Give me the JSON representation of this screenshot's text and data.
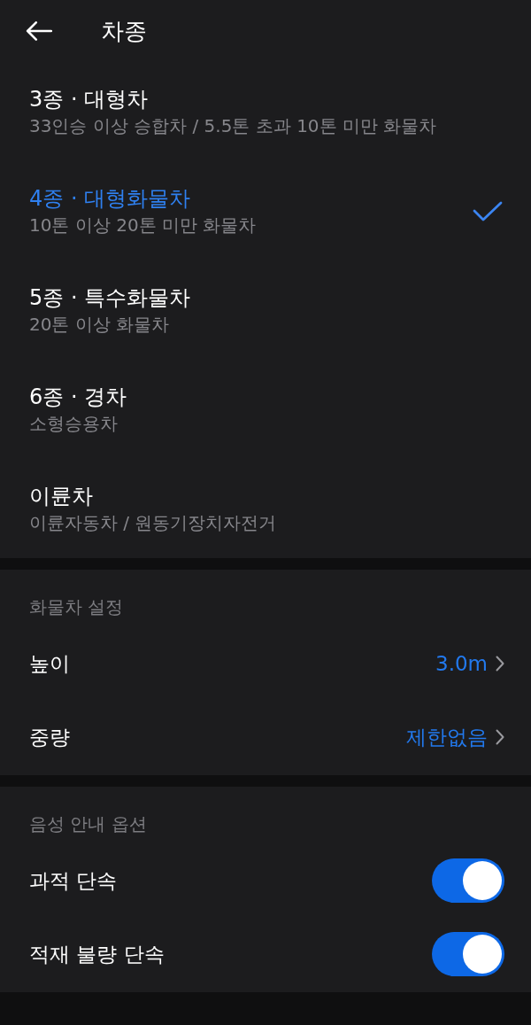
{
  "header": {
    "title": "차종"
  },
  "vehicle_types": [
    {
      "title": "3종 · 대형차",
      "description": "33인승 이상 승합차 / 5.5톤 초과 10톤 미만 화물차",
      "selected": false
    },
    {
      "title": "4종 · 대형화물차",
      "description": "10톤 이상 20톤 미만 화물차",
      "selected": true
    },
    {
      "title": "5종 · 특수화물차",
      "description": "20톤 이상 화물차",
      "selected": false
    },
    {
      "title": "6종 · 경차",
      "description": "소형승용차",
      "selected": false
    },
    {
      "title": "이륜차",
      "description": "이륜자동차 / 원동기장치자전거",
      "selected": false
    }
  ],
  "sections": [
    {
      "title": "화물차 설정",
      "rows": [
        {
          "kind": "value",
          "label": "높이",
          "value": "3.0m"
        },
        {
          "kind": "value",
          "label": "중량",
          "value": "제한없음"
        }
      ]
    },
    {
      "title": "음성 안내 옵션",
      "rows": [
        {
          "kind": "toggle",
          "label": "과적 단속",
          "on": true
        },
        {
          "kind": "toggle",
          "label": "적재 불량 단속",
          "on": true
        }
      ]
    }
  ]
}
